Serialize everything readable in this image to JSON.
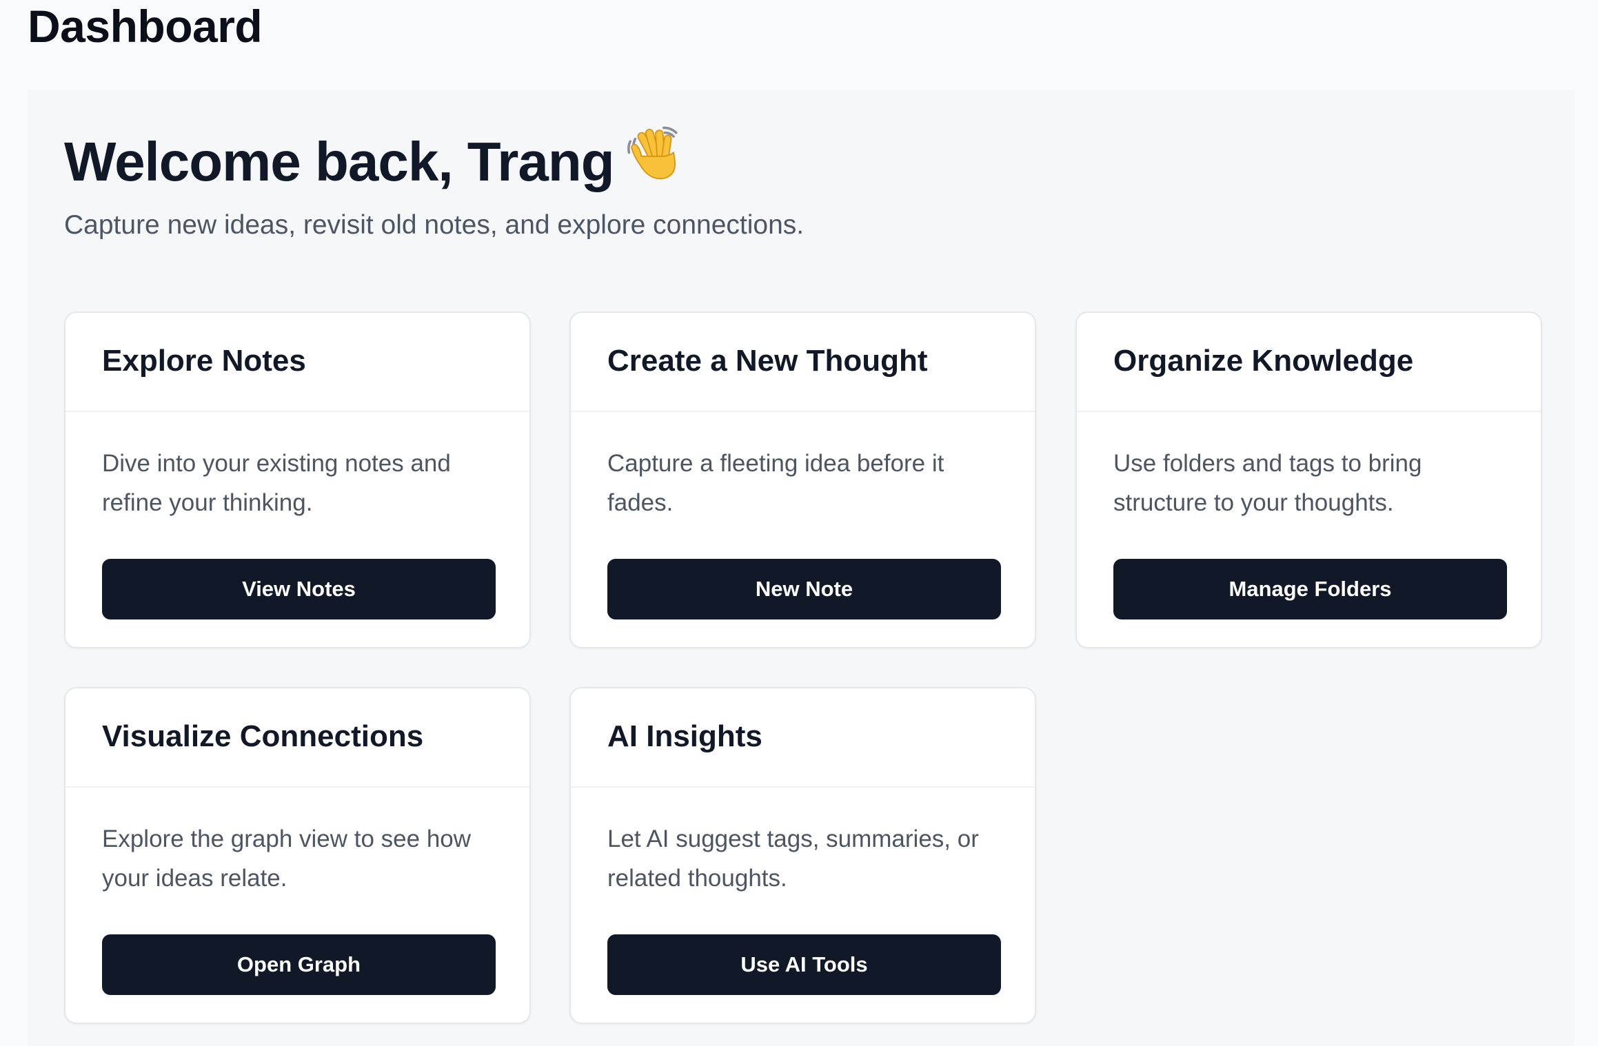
{
  "app": {
    "title": "Dashboard"
  },
  "welcome": {
    "heading": "Welcome back, Trang",
    "icon": "waving-hand-icon",
    "subtitle": "Capture new ideas, revisit old notes, and explore connections."
  },
  "cards": [
    {
      "title": "Explore Notes",
      "description": "Dive into your existing notes and refine your thinking.",
      "button_label": "View Notes"
    },
    {
      "title": "Create a New Thought",
      "description": "Capture a fleeting idea before it fades.",
      "button_label": "New Note"
    },
    {
      "title": "Organize Knowledge",
      "description": "Use folders and tags to bring structure to your thoughts.",
      "button_label": "Manage Folders"
    },
    {
      "title": "Visualize Connections",
      "description": "Explore the graph view to see how your ideas relate.",
      "button_label": "Open Graph"
    },
    {
      "title": "AI Insights",
      "description": "Let AI suggest tags, summaries, or related thoughts.",
      "button_label": "Use AI Tools"
    }
  ],
  "colors": {
    "page_background": "#f9fafb",
    "panel_background": "#f6f7f9",
    "card_background": "#ffffff",
    "card_border": "#e5e7eb",
    "button_background": "#111827",
    "button_text": "#ffffff",
    "heading_text": "#111827",
    "body_text": "#4b5563"
  }
}
